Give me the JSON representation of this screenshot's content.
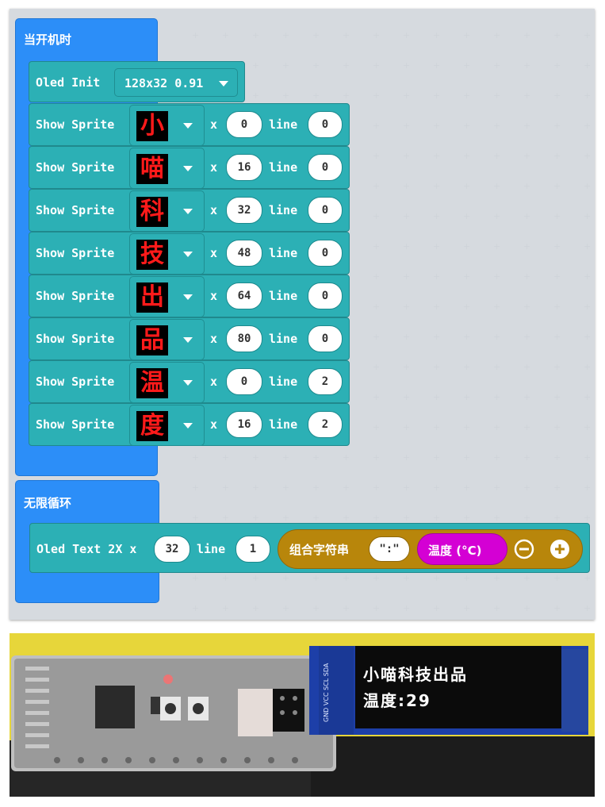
{
  "on_start": {
    "title": "当开机时",
    "oled_init": {
      "label": "Oled Init",
      "display": "128x32 0.91"
    },
    "sprites": [
      {
        "label": "Show Sprite",
        "char": "小",
        "x_label": "x",
        "x": "0",
        "line_label": "line",
        "line": "0"
      },
      {
        "label": "Show Sprite",
        "char": "喵",
        "x_label": "x",
        "x": "16",
        "line_label": "line",
        "line": "0"
      },
      {
        "label": "Show Sprite",
        "char": "科",
        "x_label": "x",
        "x": "32",
        "line_label": "line",
        "line": "0"
      },
      {
        "label": "Show Sprite",
        "char": "技",
        "x_label": "x",
        "x": "48",
        "line_label": "line",
        "line": "0"
      },
      {
        "label": "Show Sprite",
        "char": "出",
        "x_label": "x",
        "x": "64",
        "line_label": "line",
        "line": "0"
      },
      {
        "label": "Show Sprite",
        "char": "品",
        "x_label": "x",
        "x": "80",
        "line_label": "line",
        "line": "0"
      },
      {
        "label": "Show Sprite",
        "char": "温",
        "x_label": "x",
        "x": "0",
        "line_label": "line",
        "line": "2"
      },
      {
        "label": "Show Sprite",
        "char": "度",
        "x_label": "x",
        "x": "16",
        "line_label": "line",
        "line": "2"
      }
    ]
  },
  "forever": {
    "title": "无限循环",
    "oled_text": {
      "label": "Oled Text 2X x",
      "x": "32",
      "line_label": "line",
      "line": "1",
      "join_label": "组合字符串",
      "string_value": "\":\"",
      "temp_label": "温度 (°C)"
    }
  },
  "photo": {
    "pin_labels": "GND VCC SCL SDA",
    "screen_line1": "小喵科技出品",
    "screen_line2": "温度:29"
  },
  "colors": {
    "hat_blue": "#2c8ef8",
    "oled_teal": "#2cb0b5",
    "text_gold": "#b8860b",
    "sensor_magenta": "#d400d4",
    "canvas_bg": "#e9ecef",
    "photo_bg": "#e7d63a"
  }
}
